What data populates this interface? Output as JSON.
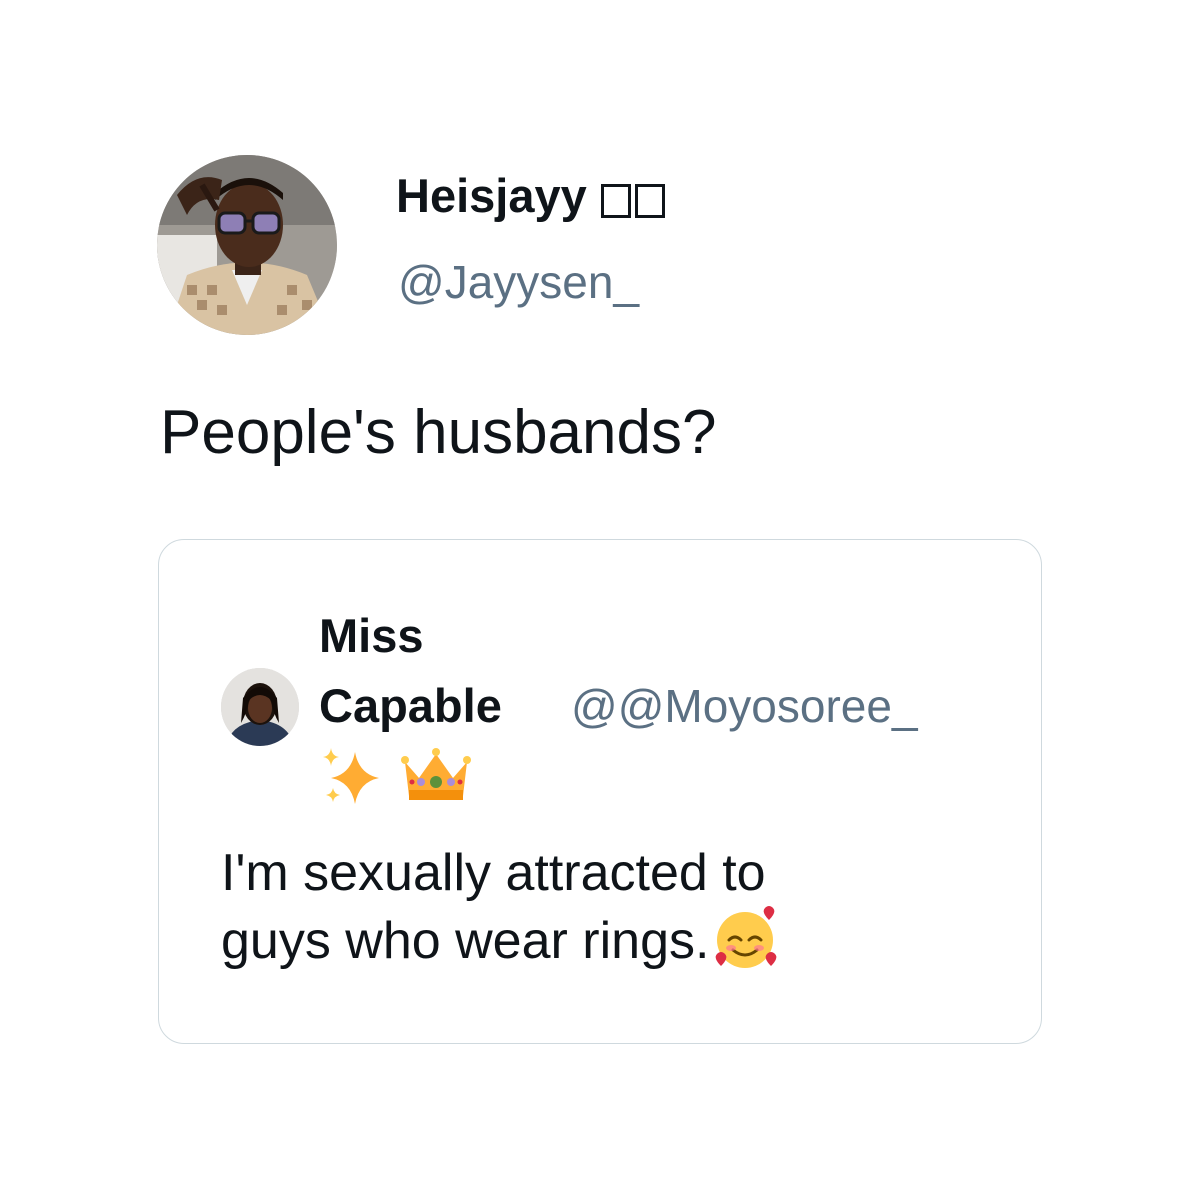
{
  "tweet": {
    "display_name": "Heisjayy",
    "handle": "@Jayysen_",
    "text": "People's husbands?"
  },
  "quoted_tweet": {
    "display_name_line1": "Miss",
    "display_name_line2": "Capable",
    "handle": "@@Moyosoree_",
    "name_emojis": [
      "sparkles-icon",
      "crown-icon"
    ],
    "text_line1": "I'm sexually attracted to",
    "text_line2": "guys who wear rings.",
    "text_emoji": "smiling-face-with-hearts-icon"
  },
  "colors": {
    "text_primary": "#0f1419",
    "text_secondary": "#5b7083",
    "border": "#cfd9de",
    "background": "#ffffff"
  }
}
